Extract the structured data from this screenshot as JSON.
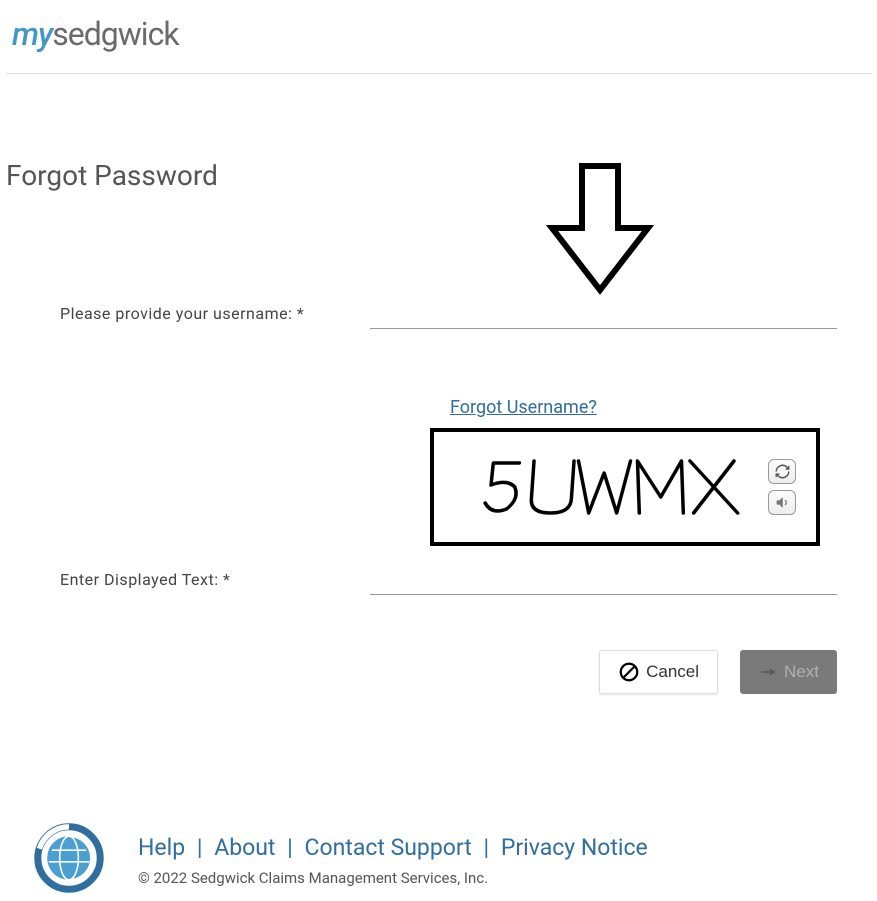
{
  "logo": {
    "prefix": "my",
    "suffix": "sedgwick"
  },
  "page_title": "Forgot Password",
  "form": {
    "username_label": "Please provide your username: *",
    "username_value": "",
    "forgot_username_link": "Forgot Username?",
    "captcha_text": "5UWMX",
    "captcha_label": "Enter Displayed Text: *",
    "captcha_value": ""
  },
  "buttons": {
    "cancel": "Cancel",
    "next": "Next"
  },
  "footer": {
    "links": {
      "help": "Help",
      "about": "About",
      "contact": "Contact Support",
      "privacy": "Privacy Notice"
    },
    "separator": "|",
    "copyright": "© 2022 Sedgwick Claims Management Services, Inc."
  }
}
